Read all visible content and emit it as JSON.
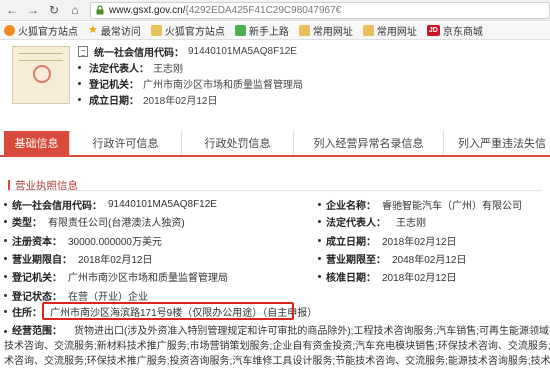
{
  "browser": {
    "url_host": "www.gsxt.gov.cn/",
    "url_path": "{4292EDA425F41C29C98047967€",
    "bookmarks": [
      "火狐官方站点",
      "最常访问",
      "火狐官方站点",
      "新手上路",
      "常用网址",
      "常用网址",
      "京东商城"
    ]
  },
  "summary": {
    "rows": [
      {
        "label": "统一社会信用代码：",
        "value": "91440101MA5AQ8F12E"
      },
      {
        "label": "法定代表人：",
        "value": "王志刚"
      },
      {
        "label": "登记机关：",
        "value": "广州市南沙区市场和质量监督管理局"
      },
      {
        "label": "成立日期：",
        "value": "2018年02月12日"
      }
    ]
  },
  "tabs": [
    "基础信息",
    "行政许可信息",
    "行政处罚信息",
    "列入经营异常名录信息",
    "列入严重违法失信"
  ],
  "section_title": "营业执照信息",
  "details": {
    "credit_code": {
      "label": "统一社会信用代码：",
      "value": "91440101MA5AQ8F12E"
    },
    "company_name": {
      "label": "企业名称：",
      "value": "睿驰智能汽车（广州）有限公司"
    },
    "type": {
      "label": "类型：",
      "value": "有限责任公司(台港澳法人独资)"
    },
    "legal_rep": {
      "label": "法定代表人：",
      "value": "王志刚"
    },
    "capital": {
      "label": "注册资本：",
      "value": "30000.000000万美元"
    },
    "established": {
      "label": "成立日期：",
      "value": "2018年02月12日"
    },
    "term_from": {
      "label": "营业期限自：",
      "value": "2018年02月12日"
    },
    "term_to": {
      "label": "营业期限至：",
      "value": "2048年02月12日"
    },
    "authority": {
      "label": "登记机关：",
      "value": "广州市南沙区市场和质量监督管理局"
    },
    "approved": {
      "label": "核准日期：",
      "value": "2018年02月12日"
    },
    "status": {
      "label": "登记状态：",
      "value": "在营（开业）企业"
    },
    "address": {
      "label": "住所：",
      "value": "广州市南沙区海滨路171号9楼（仅限办公用途）（自主申报）"
    },
    "scope": {
      "label": "经营范围：",
      "lines": [
        "货物进出口(涉及外资准入特别管理规定和许可审批的商品除外);工程技术咨询服务;汽车销售;可再生能源领域技术咨询、技术服务;新材料",
        "技术咨询、交流服务;新材料技术推广服务;市场营销策划服务;企业自有资金投资;汽车充电模块销售;环保技术咨询、交流服务;发动机制造管理系统",
        "术咨询、交流服务;环保技术推广服务;投资咨询服务;汽车维修工具设计服务;节能技术咨询、交流服务;能源技术咨询服务;技术进出口;汽车零售;汽车"
      ]
    }
  }
}
